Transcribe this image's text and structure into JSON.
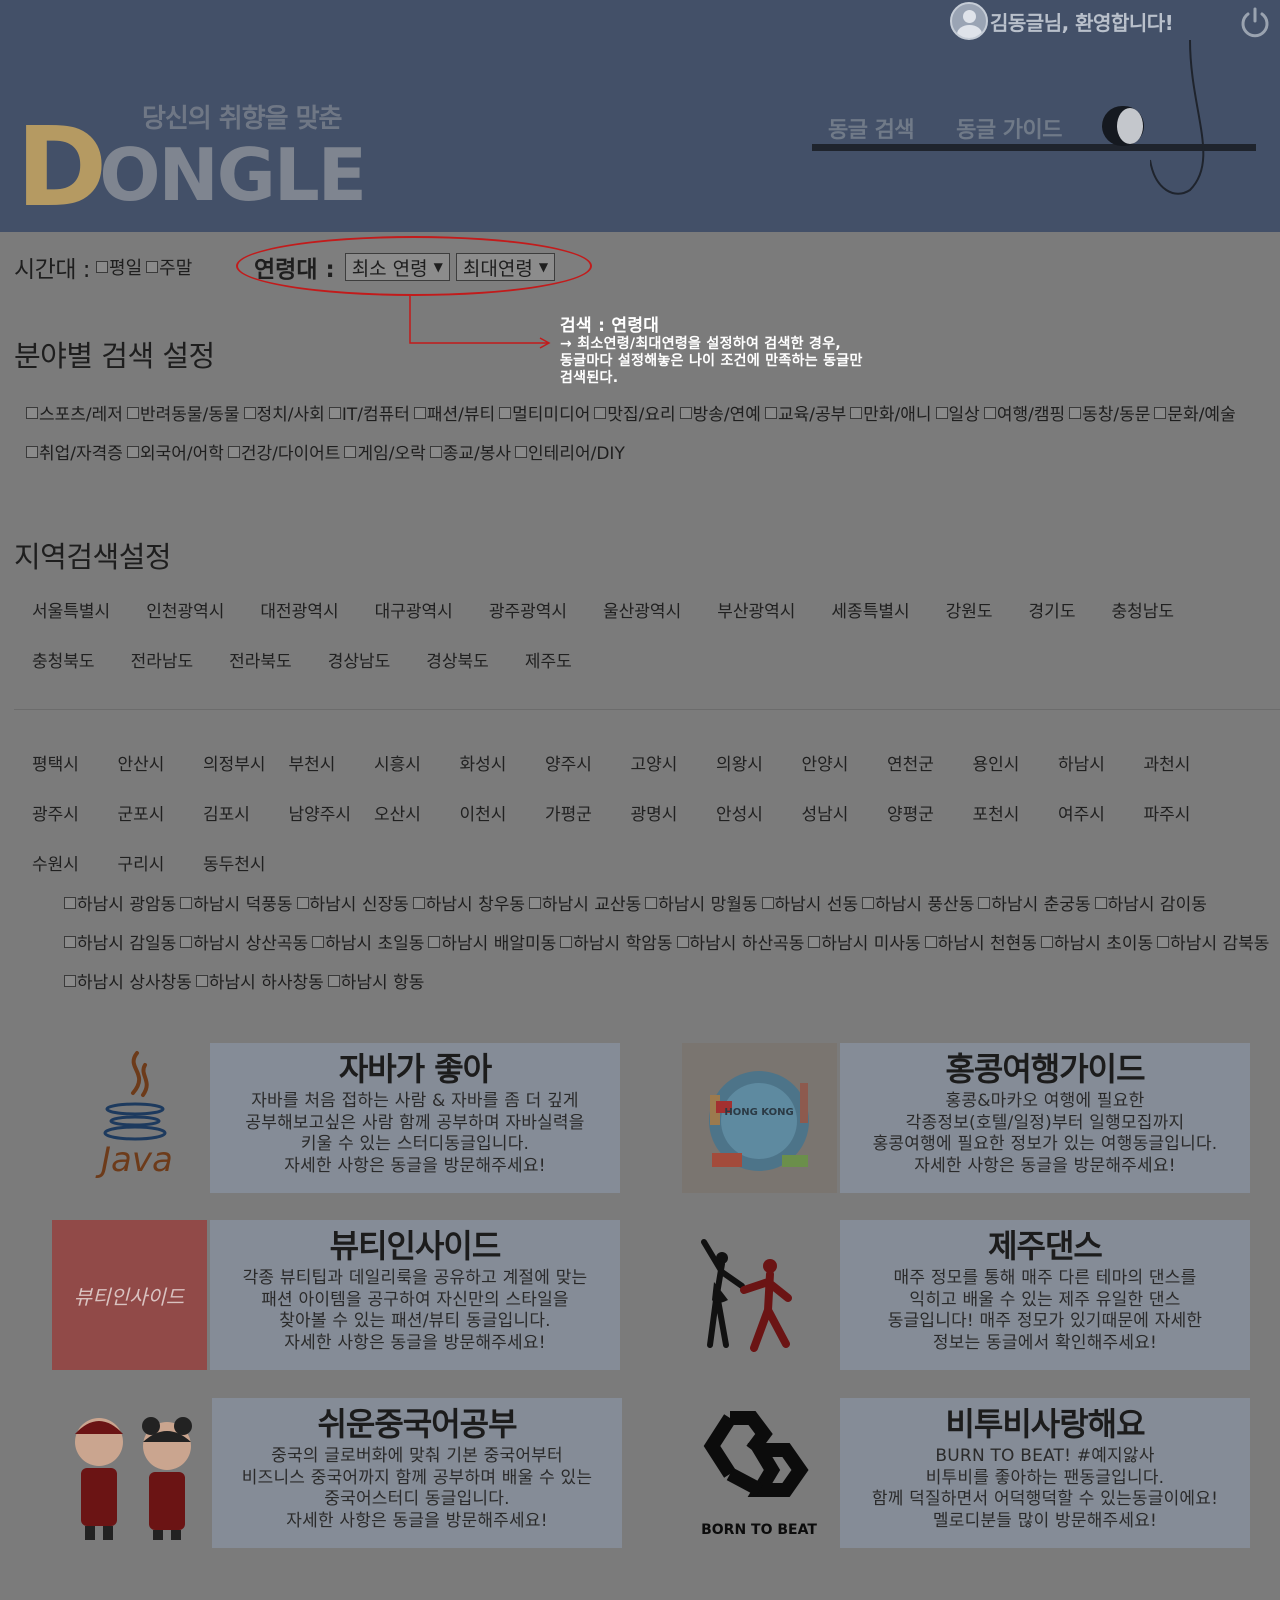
{
  "header": {
    "greeting": "김동글님, 환영합니다!",
    "brand_tagline": "당신의 취향을 맞춘",
    "brand_initial": "D",
    "brand_rest": "ONGLE",
    "nav": [
      "동글 검색",
      "동글 가이드"
    ],
    "colors": {
      "header_bg": "#435068",
      "logo_d": "#b59a62"
    }
  },
  "search": {
    "time_label": "시간대 :",
    "time_options": [
      "평일",
      "주말"
    ],
    "age_label": "연령대 :",
    "age_min_selected": "최소 연령",
    "age_max_selected": "최대연령",
    "callout_title": "검색 : 연령대",
    "callout_lines": [
      "→ 최소연령/최대연령을 설정하여 검색한 경우,",
      "동글마다 설정해놓은 나이 조건에 만족하는 동글만",
      "검색된다."
    ],
    "category_title": "분야별 검색 설정",
    "categories": [
      "스포츠/레저",
      "반려동물/동물",
      "정치/사회",
      "IT/컴퓨터",
      "패션/뷰티",
      "멀티미디어",
      "맛집/요리",
      "방송/연예",
      "교육/공부",
      "만화/애니",
      "일상",
      "여행/캠핑",
      "동창/동문",
      "문화/예술",
      "취업/자격증",
      "외국어/어학",
      "건강/다이어트",
      "게임/오락",
      "종교/봉사",
      "인테리어/DIY"
    ],
    "region_title": "지역검색설정",
    "regions_row1": [
      "서울특별시",
      "인천광역시",
      "대전광역시",
      "대구광역시",
      "광주광역시",
      "울산광역시",
      "부산광역시",
      "세종특별시",
      "강원도",
      "경기도",
      "충청남도"
    ],
    "regions_row2": [
      "충청북도",
      "전라남도",
      "전라북도",
      "경상남도",
      "경상북도",
      "제주도"
    ],
    "cities_row1": [
      "평택시",
      "안산시",
      "의정부시",
      "부천시",
      "시흥시",
      "화성시",
      "양주시",
      "고양시",
      "의왕시",
      "안양시",
      "연천군",
      "용인시",
      "하남시",
      "과천시"
    ],
    "cities_row2": [
      "광주시",
      "군포시",
      "김포시",
      "남양주시",
      "오산시",
      "이천시",
      "가평군",
      "광명시",
      "안성시",
      "성남시",
      "양평군",
      "포천시",
      "여주시",
      "파주시"
    ],
    "cities_row3": [
      "수원시",
      "구리시",
      "동두천시"
    ],
    "dongs": [
      "하남시 광암동",
      "하남시 덕풍동",
      "하남시 신장동",
      "하남시 창우동",
      "하남시 교산동",
      "하남시 망월동",
      "하남시 선동",
      "하남시 풍산동",
      "하남시 춘궁동",
      "하남시 감이동",
      "하남시 감일동",
      "하남시 상산곡동",
      "하남시 초일동",
      "하남시 배알미동",
      "하남시 학암동",
      "하남시 하산곡동",
      "하남시 미사동",
      "하남시 천현동",
      "하남시 초이동",
      "하남시 감북동",
      "하남시 상사창동",
      "하남시 하사창동",
      "하남시 항동"
    ]
  },
  "cards": [
    {
      "title": "자바가 좋아",
      "icon": "java-logo",
      "desc": [
        "자바를 처음 접하는 사람 & 자바를 좀 더 깊게",
        "공부해보고싶은 사람 함께 공부하며 자바실력을",
        "키울 수 있는 스터디동글입니다.",
        "자세한 사항은 동글을 방문해주세요!"
      ]
    },
    {
      "title": "홍콩여행가이드",
      "icon": "hongkong-travel-illustration",
      "img_text": "HONG KONG",
      "desc": [
        "홍콩&마카오 여행에 필요한",
        "각종정보(호텔/일정)부터 일행모집까지",
        "홍콩여행에 필요한 정보가 있는 여행동글입니다.",
        "자세한 사항은 동글을 방문해주세요!"
      ]
    },
    {
      "title": "뷰티인사이드",
      "icon": "beauty-inside-logo",
      "img_text": "뷰티인사이드",
      "desc": [
        "각종 뷰티팁과 데일리룩을 공유하고 계절에 맞는",
        "패션 아이템을 공구하여 자신만의 스타일을",
        "찾아볼 수 있는 패션/뷰티 동글입니다.",
        "자세한 사항은 동글을 방문해주세요!"
      ]
    },
    {
      "title": "제주댄스",
      "icon": "dancing-couple-illustration",
      "desc": [
        "매주 정모를 통해 매주 다른 테마의 댄스를",
        "익히고 배울 수 있는 제주 유일한 댄스",
        "동글입니다! 매주 정모가 있기때문에 자세한",
        "정보는 동글에서 확인해주세요!"
      ]
    },
    {
      "title": "쉬운중국어공부",
      "icon": "chinese-kids-illustration",
      "desc": [
        "중국의 글로버화에 맞춰 기본 중국어부터",
        "비즈니스 중국어까지 함께 공부하며 배울 수 있는",
        "중국어스터디 동글입니다.",
        "자세한 사항은 동글을 방문해주세요!"
      ]
    },
    {
      "title": "비투비사랑해요",
      "icon": "btob-logo",
      "img_text": "BORN TO BEAT",
      "desc": [
        "BURN TO BEAT! #예지앓사",
        "비투비를 좋아하는 팬동글입니다.",
        "함께 덕질하면서 어덕행덕할 수 있는동글이에요!",
        "멜로디분들 많이 방문해주세요!"
      ]
    }
  ]
}
